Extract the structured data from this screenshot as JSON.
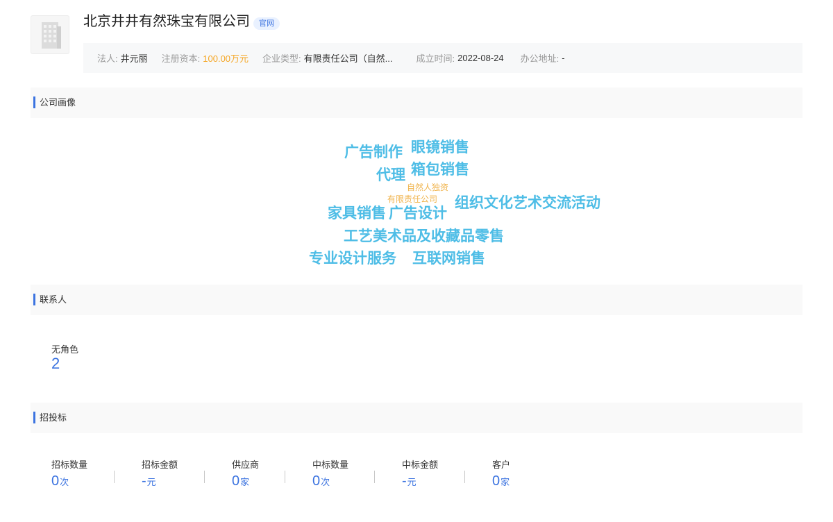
{
  "company": {
    "name": "北京井井有然珠宝有限公司",
    "official_tag": "官网",
    "logo_icon": "building-icon"
  },
  "info": [
    {
      "label": "法人:",
      "value": "井元丽"
    },
    {
      "label": "注册资本:",
      "value": "100.00万元"
    },
    {
      "label": "企业类型:",
      "value": "有限责任公司（自然..."
    },
    {
      "label": "成立时间:",
      "value": "2022-08-24"
    },
    {
      "label": "办公地址:",
      "value": "-"
    }
  ],
  "sections": {
    "profile": "公司画像",
    "contacts": "联系人",
    "bidding": "招投标"
  },
  "word_cloud": [
    "广告制作",
    "眼镜销售",
    "代理",
    "箱包销售",
    "自然人独资",
    "有限责任公司",
    "家具销售",
    "广告设计",
    "组织文化艺术交流活动",
    "工艺美术品及收藏品零售",
    "专业设计服务",
    "互联网销售"
  ],
  "contacts": {
    "label": "无角色",
    "value": "2"
  },
  "bidding_stats": [
    {
      "label": "招标数量",
      "value": "0",
      "unit": "次"
    },
    {
      "label": "招标金额",
      "value": "-",
      "unit": "元"
    },
    {
      "label": "供应商",
      "value": "0",
      "unit": "家"
    },
    {
      "label": "中标数量",
      "value": "0",
      "unit": "次"
    },
    {
      "label": "中标金额",
      "value": "-",
      "unit": "元"
    },
    {
      "label": "客户",
      "value": "0",
      "unit": "家"
    }
  ],
  "colors": {
    "accent": "#3b73e0",
    "cloud_primary": "#4ebde6",
    "cloud_secondary": "#f0b34b",
    "capital": "#f5a623"
  }
}
